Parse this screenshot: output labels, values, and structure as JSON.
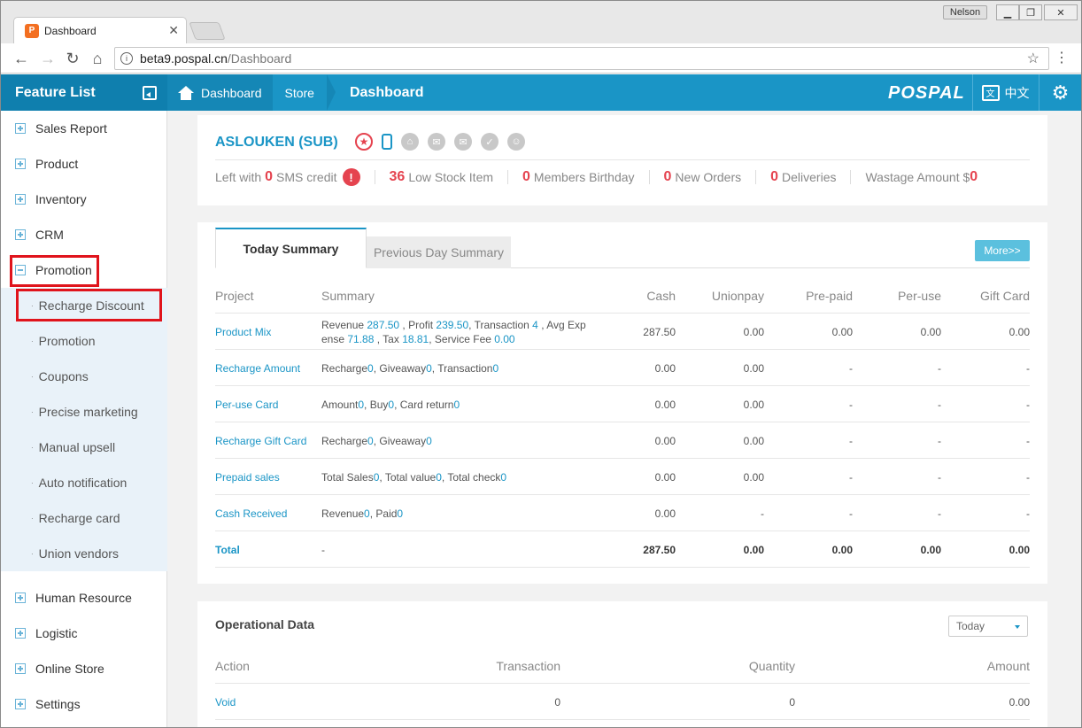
{
  "browser": {
    "tab_title": "Dashboard",
    "tab_favicon_letter": "P",
    "user": "Nelson",
    "url_host": "beta9.pospal.cn",
    "url_path": "/Dashboard"
  },
  "topbar": {
    "feature_list": "Feature List",
    "breadcrumb_home": "Dashboard",
    "breadcrumb_store": "Store",
    "breadcrumb_current": "Dashboard",
    "logo": "POSPAL",
    "language": "中文",
    "accent_color": "#1a95c6"
  },
  "sidebar": {
    "items": [
      {
        "label": "Sales Report"
      },
      {
        "label": "Product"
      },
      {
        "label": "Inventory"
      },
      {
        "label": "CRM"
      },
      {
        "label": "Promotion"
      }
    ],
    "sub_items": [
      {
        "label": "Recharge Discount"
      },
      {
        "label": "Promotion"
      },
      {
        "label": "Coupons"
      },
      {
        "label": "Precise marketing"
      },
      {
        "label": "Manual upsell"
      },
      {
        "label": "Auto notification"
      },
      {
        "label": "Recharge card"
      },
      {
        "label": "Union vendors"
      }
    ],
    "items_after": [
      {
        "label": "Human Resource"
      },
      {
        "label": "Logistic"
      },
      {
        "label": "Online Store"
      },
      {
        "label": "Settings"
      }
    ]
  },
  "store": {
    "name": "ASLOUKEN (SUB)",
    "stats": {
      "sms_prefix": "Left with",
      "sms_value": "0",
      "sms_label": "SMS credit",
      "low_stock_value": "36",
      "low_stock_label": "Low Stock Item",
      "birthday_value": "0",
      "birthday_label": "Members Birthday",
      "orders_value": "0",
      "orders_label": "New Orders",
      "deliveries_value": "0",
      "deliveries_label": "Deliveries",
      "wastage_label": "Wastage Amount $",
      "wastage_value": "0"
    }
  },
  "summary": {
    "tab_today": "Today Summary",
    "tab_previous": "Previous Day Summary",
    "more": "More>>",
    "headers": [
      "Project",
      "Summary",
      "Cash",
      "Unionpay",
      "Pre-paid",
      "Per-use",
      "Gift Card"
    ],
    "rows": [
      {
        "project": "Product Mix",
        "summary_line1_a": "Revenue ",
        "summary_line1_b": "287.50",
        "summary_line1_c": " , Profit ",
        "summary_line1_d": "239.50",
        "summary_line1_e": ", Transaction ",
        "summary_line1_f": "4",
        "summary_line1_g": " , Avg Exp",
        "summary_line2_a": "ense ",
        "summary_line2_b": "71.88",
        "summary_line2_c": " , Tax ",
        "summary_line2_d": "18.81",
        "summary_line2_e": ", Service Fee ",
        "summary_line2_f": "0.00",
        "cash": "287.50",
        "unionpay": "0.00",
        "prepaid": "0.00",
        "peruse": "0.00",
        "giftcard": "0.00"
      },
      {
        "project": "Recharge Amount",
        "s1": "Recharge ",
        "v1": "0",
        "s2": ", Giveaway ",
        "v2": "0",
        "s3": ", Transaction ",
        "v3": "0",
        "cash": "0.00",
        "unionpay": "0.00",
        "prepaid": "-",
        "peruse": "-",
        "giftcard": "-"
      },
      {
        "project": "Per-use Card",
        "s1": "Amount ",
        "v1": "0",
        "s2": ", Buy ",
        "v2": "0",
        "s3": ", Card return ",
        "v3": "0",
        "cash": "0.00",
        "unionpay": "0.00",
        "prepaid": "-",
        "peruse": "-",
        "giftcard": "-"
      },
      {
        "project": "Recharge Gift Card",
        "s1": "Recharge ",
        "v1": "0",
        "s2": ", Giveaway ",
        "v2": "0",
        "s3": "",
        "v3": "",
        "cash": "0.00",
        "unionpay": "0.00",
        "prepaid": "-",
        "peruse": "-",
        "giftcard": "-"
      },
      {
        "project": "Prepaid sales",
        "s1": "Total Sales ",
        "v1": "0",
        "s2": ", Total value ",
        "v2": "0",
        "s3": ", Total check ",
        "v3": "0",
        "cash": "0.00",
        "unionpay": "0.00",
        "prepaid": "-",
        "peruse": "-",
        "giftcard": "-"
      },
      {
        "project": "Cash Received",
        "s1": "Revenue ",
        "v1": "0",
        "s2": ", Paid ",
        "v2": "0",
        "s3": "",
        "v3": "",
        "cash": "0.00",
        "unionpay": "-",
        "prepaid": "-",
        "peruse": "-",
        "giftcard": "-"
      },
      {
        "project": "Total",
        "s1": "-",
        "v1": "",
        "s2": "",
        "v2": "",
        "s3": "",
        "v3": "",
        "cash": "287.50",
        "unionpay": "0.00",
        "prepaid": "0.00",
        "peruse": "0.00",
        "giftcard": "0.00"
      }
    ]
  },
  "operational": {
    "title": "Operational Data",
    "period": "Today",
    "headers": [
      "Action",
      "Transaction",
      "Quantity",
      "Amount"
    ],
    "rows": [
      {
        "action": "Void",
        "transaction": "0",
        "quantity": "0",
        "amount": "0.00"
      }
    ]
  }
}
